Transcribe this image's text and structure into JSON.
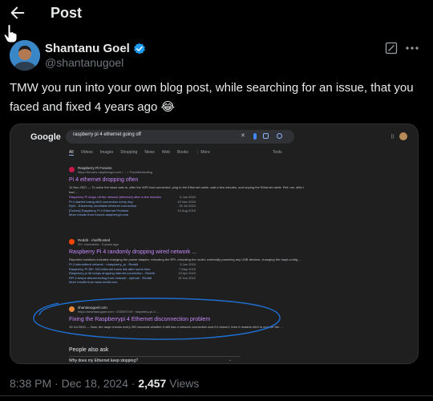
{
  "header": {
    "title": "Post",
    "back_icon": "arrow-left-icon"
  },
  "author": {
    "name": "Shantanu Goel",
    "handle": "@shantanugoel",
    "verified_color": "#1d9bf0"
  },
  "tweet": {
    "text": "TMW you run into your own blog post, while searching for an issue, that you faced and fixed 4 years ago 😂"
  },
  "screenshot": {
    "logo": "Google",
    "query": "raspberry pi 4 ethernet going off",
    "tabs": [
      "All",
      "Videos",
      "Images",
      "Shopping",
      "News",
      "Web",
      "Books",
      "⋮ More"
    ],
    "tools": "Tools",
    "results": [
      {
        "site_name": "Raspberry Pi Forums",
        "site_url": "https://forums.raspberrypi.com › ... › Troubleshooting",
        "title": "Pi 4 ethernet dropping often",
        "snippet": "11 Nov 2021 — To solve the issue was to, after the WiFi had connected, plug in the Ethernet cable, wait a few minutes, and unplug the Ethernet cable. Ref: me, after I had ...",
        "sublinks": [
          {
            "label": "Raspberry Pi drops off the network (ethernet) after a few minutes",
            "date": "6 Jan 2024"
          },
          {
            "label": "Pi 4 started losing eth0 connection every day",
            "date": "19 Nov 2023"
          },
          {
            "label": "Rpi4 - Extremely unreliable ethernet connection",
            "date": "25 Jul 2023"
          },
          {
            "label": "[Solved] Raspberry Pi 4 Ethernet Problem",
            "date": "10 Aug 2019"
          }
        ],
        "more": "More results from forums.raspberrypi.com"
      },
      {
        "site_name": "Reddit · r/selfhosted",
        "site_url": "20+ comments · 3 years ago",
        "title": "Raspberry Pi 4 randomly dropping wired network ...",
        "snippet": "Reported solutions included changing the power adapter, rebooting the RPi, rebooting the router, externally powering any USB devices, changing the raspi-config ...",
        "sublinks": [
          {
            "label": "Pi 4 intermittent network : r/raspberry_pi - Reddit",
            "date": "3 Jan 2024"
          },
          {
            "label": "Raspberry Pi 3B+ NIC/ethernet loses link after some time",
            "date": "7 May 2019"
          },
          {
            "label": "Raspberry pi 4b keeps dropping internet connection - Reddit",
            "date": "19 Apr 2023"
          },
          {
            "label": "RPi 4 keeps disconnecting from network : r/pihole - Reddit",
            "date": "15 Jun 2022"
          }
        ],
        "more": "More results from www.reddit.com"
      },
      {
        "site_name": "shantanugoel.com",
        "site_url": "https://shantanugoel.com › 2020/07/19 › raspberry-pi-4 ...",
        "title": "Fixing the Raspberrypi 4 Ethernet disconnection problem",
        "snippet": "19 Jul 2020 — Now, the raspi checks every 200 seconds whether it still has a network connection and if it doesn't, then it restarts eth0 to recover the ..."
      }
    ],
    "people_also_ask": "People also ask",
    "paa_question": "Why does my Ethernet keep stopping?"
  },
  "meta": {
    "time": "8:38 PM · Dec 18, 2024 · ",
    "views_count": "2,457",
    "views_label": " Views"
  }
}
